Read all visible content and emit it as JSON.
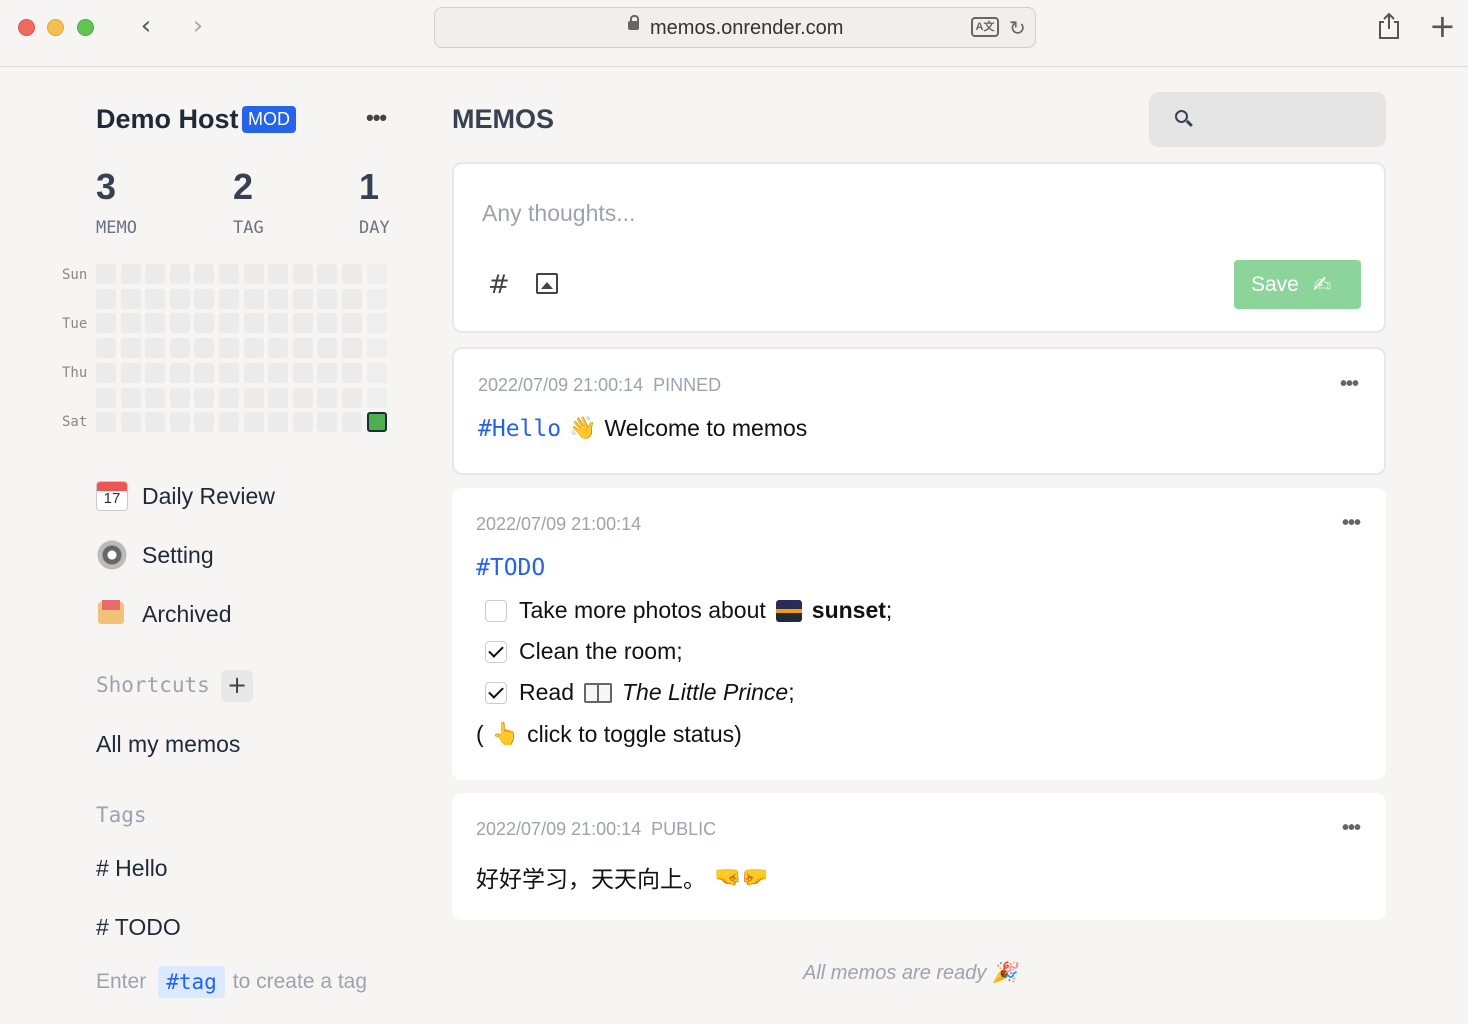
{
  "browser": {
    "url": "memos.onrender.com"
  },
  "sidebar": {
    "host_name": "Demo Host",
    "badge": "MOD",
    "stats": [
      {
        "value": "3",
        "label": "MEMO"
      },
      {
        "value": "2",
        "label": "TAG"
      },
      {
        "value": "1",
        "label": "DAY"
      }
    ],
    "day_labels": [
      "Sun",
      "Tue",
      "Thu",
      "Sat"
    ],
    "nav": {
      "daily_review": "Daily Review",
      "setting": "Setting",
      "archived": "Archived"
    },
    "calendar_day": "17",
    "shortcuts_title": "Shortcuts",
    "shortcut_all": "All my memos",
    "tags_title": "Tags",
    "tags": [
      "# Hello",
      "# TODO"
    ],
    "hint": {
      "prefix": "Enter",
      "chip": "#tag",
      "suffix": "to create a tag"
    }
  },
  "main": {
    "title": "MEMOS",
    "search": {
      "value": "",
      "placeholder": ""
    },
    "editor": {
      "placeholder": "Any thoughts...",
      "save_label": "Save"
    },
    "memos": [
      {
        "time": "2022/07/09 21:00:14",
        "flag": "PINNED",
        "tag": "#Hello",
        "text": "Welcome to memos"
      },
      {
        "time": "2022/07/09 21:00:14",
        "flag": "",
        "tag": "#TODO",
        "todos": [
          {
            "text": "Take more photos about",
            "bold": "sunset",
            "end": ";",
            "checked": false
          },
          {
            "text": "Clean the room;",
            "checked": true
          },
          {
            "text": "Read",
            "italic": "The Little Prince",
            "end": ";",
            "checked": true
          }
        ],
        "note_open": "(",
        "note": "click to toggle status)"
      },
      {
        "time": "2022/07/09 21:00:14",
        "flag": "PUBLIC",
        "text": "好好学习，天天向上。"
      }
    ],
    "footer": "All memos are ready"
  },
  "colors": {
    "accent": "#2563eb",
    "save": "#8dd49b",
    "heat_active": "#4caf50"
  },
  "heatmap": {
    "weeks": 12,
    "days": 7,
    "active_cells": 1
  }
}
